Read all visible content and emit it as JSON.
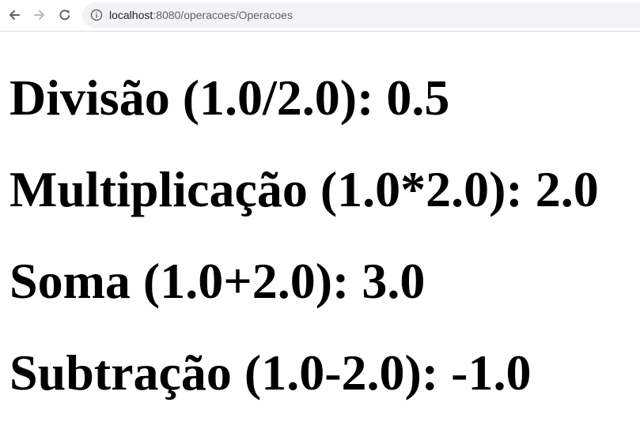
{
  "browser": {
    "url_host": "localhost",
    "url_rest": ":8080/operacoes/Operacoes"
  },
  "page": {
    "results": [
      "Divisão (1.0/2.0): 0.5",
      "Multiplicação (1.0*2.0): 2.0",
      "Soma (1.0+2.0): 3.0",
      "Subtração (1.0-2.0): -1.0"
    ]
  }
}
